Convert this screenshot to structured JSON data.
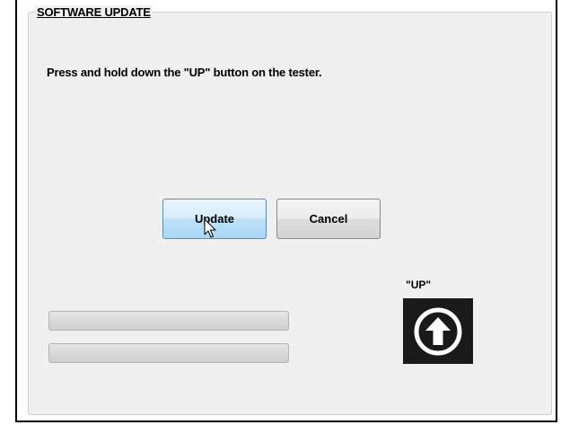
{
  "panel": {
    "title": "SOFTWARE UPDATE",
    "instruction": "Press and hold down the \"UP\" button on the tester."
  },
  "buttons": {
    "update_label": "Update",
    "cancel_label": "Cancel"
  },
  "progress_bars": [
    {
      "value": 0
    },
    {
      "value": 0
    }
  ],
  "up_indicator": {
    "label": "\"UP\"",
    "icon": "arrow-up-circle-icon"
  },
  "colors": {
    "panel_background": "#f0f0f0",
    "update_button_accent": "#4a8fcf",
    "icon_background": "#1a1a1a"
  }
}
